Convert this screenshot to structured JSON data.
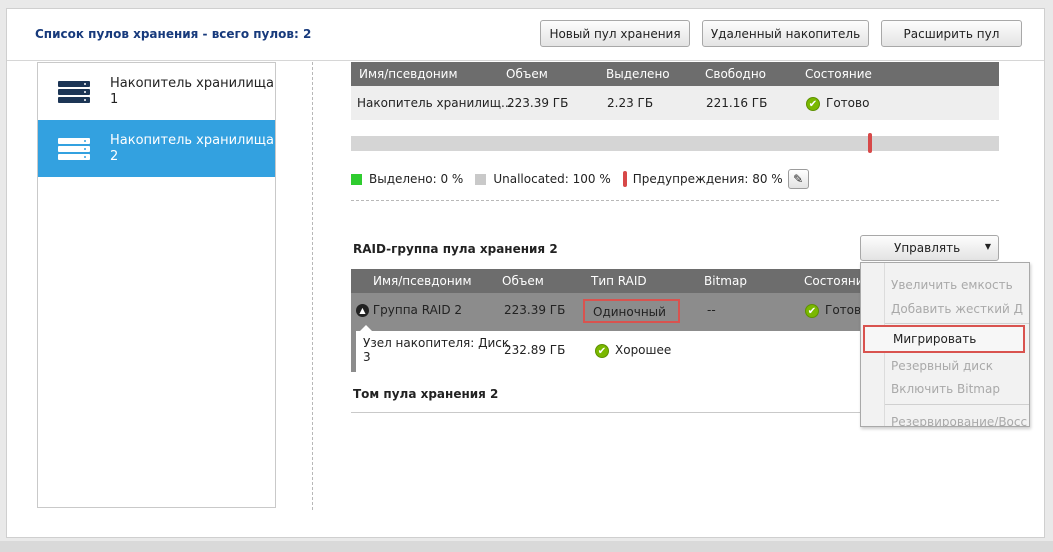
{
  "header": {
    "title": "Список пулов хранения - всего пулов: 2",
    "buttons": [
      "Новый пул хранения",
      "Удаленный накопитель",
      "Расширить пул"
    ]
  },
  "pools": [
    {
      "line1": "Накопитель хранилища",
      "line2": "1",
      "icon": "server-icon",
      "selected": false
    },
    {
      "line1": "Накопитель хранилища",
      "line2": "2",
      "icon": "server-icon",
      "selected": true
    }
  ],
  "pool_table": {
    "columns": [
      "Имя/псевдоним",
      "Объем",
      "Выделено",
      "Свободно",
      "Состояние"
    ],
    "row": {
      "name": "Накопитель хранилищ...",
      "size": "223.39 ГБ",
      "allocated": "2.23 ГБ",
      "free": "221.16 ГБ",
      "status": "Готово",
      "status_icon": "check-icon"
    }
  },
  "usage": {
    "allocated_label": "Выделено: 0 %",
    "unallocated_label": "Unallocated: 100 %",
    "warning_label": "Предупреждения: 80 %",
    "warning_threshold_percent": 80,
    "colors": {
      "allocated": "#2fcc2f",
      "unallocated": "#c9c9c9",
      "warning": "#d74848"
    }
  },
  "raid_section": {
    "title": "RAID-группа пула хранения 2",
    "manage_label": "Управлять",
    "columns": [
      "Имя/псевдоним",
      "Объем",
      "Тип RAID",
      "Bitmap",
      "Состояние"
    ],
    "group_row": {
      "name": "Группа RAID 2",
      "size": "223.39 ГБ",
      "raid_type": "Одиночный",
      "bitmap": "--",
      "status": "Готово"
    },
    "node_row": {
      "name_line1": "Узел накопителя: Диск",
      "name_line2": "3",
      "size": "232.89 ГБ",
      "status": "Хорошее"
    }
  },
  "volume_section": {
    "title": "Том пула хранения 2"
  },
  "manage_menu": {
    "items": [
      {
        "label": "Увеличить емкость",
        "enabled": false
      },
      {
        "label": "Добавить жесткий Д",
        "enabled": false
      },
      {
        "label": "Мигрировать",
        "enabled": true,
        "highlighted": true
      },
      {
        "label": "Резервный диск",
        "enabled": false
      },
      {
        "label": "Включить Bitmap",
        "enabled": false
      },
      {
        "label": "Резервирование/Восс",
        "enabled": false
      }
    ]
  }
}
